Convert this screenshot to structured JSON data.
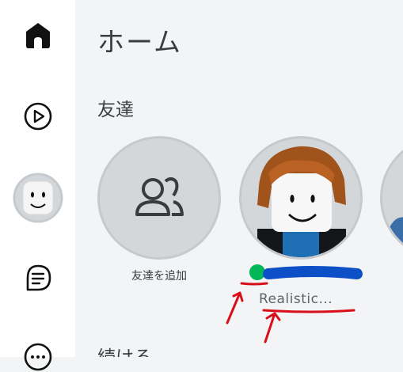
{
  "header": {
    "title": "ホーム"
  },
  "sections": {
    "friends": {
      "title": "友達",
      "add_friend_label": "友達を追加"
    },
    "continue": {
      "title": "続ける"
    }
  },
  "friends": [
    {
      "display_name": "Realistic...",
      "status": "online"
    }
  ],
  "colors": {
    "online": "#02b757",
    "annotation_red": "#d80e1a",
    "annotation_blue": "#0d4fc7",
    "background": "#f2f4f5"
  },
  "sidebar": {
    "items": [
      {
        "icon": "home-icon"
      },
      {
        "icon": "play-icon"
      },
      {
        "icon": "avatar"
      },
      {
        "icon": "chat-icon"
      },
      {
        "icon": "more-icon"
      }
    ]
  }
}
